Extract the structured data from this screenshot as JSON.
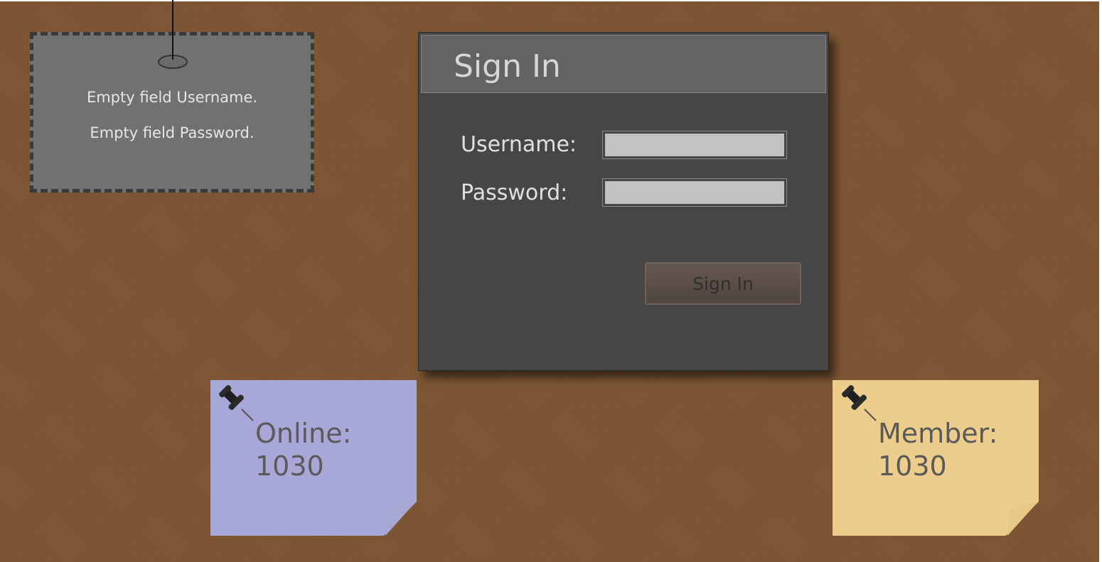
{
  "error_sign": {
    "messages": [
      "Empty field Username.",
      "Empty field Password."
    ]
  },
  "signin": {
    "title": "Sign In",
    "username_label": "Username:",
    "username_value": "",
    "password_label": "Password:",
    "password_value": "",
    "button_label": "Sign In"
  },
  "notes": {
    "online": {
      "label": "Online:",
      "value": "1030",
      "color": "#a8a8d8"
    },
    "member": {
      "label": "Member:",
      "value": "1030",
      "color": "#eccd8c"
    }
  },
  "icons": {
    "pin": "push-pin-icon"
  },
  "colors": {
    "background": "#7d5532",
    "panel": "#464646",
    "panel_header": "#636363",
    "error_box": "#717171"
  }
}
